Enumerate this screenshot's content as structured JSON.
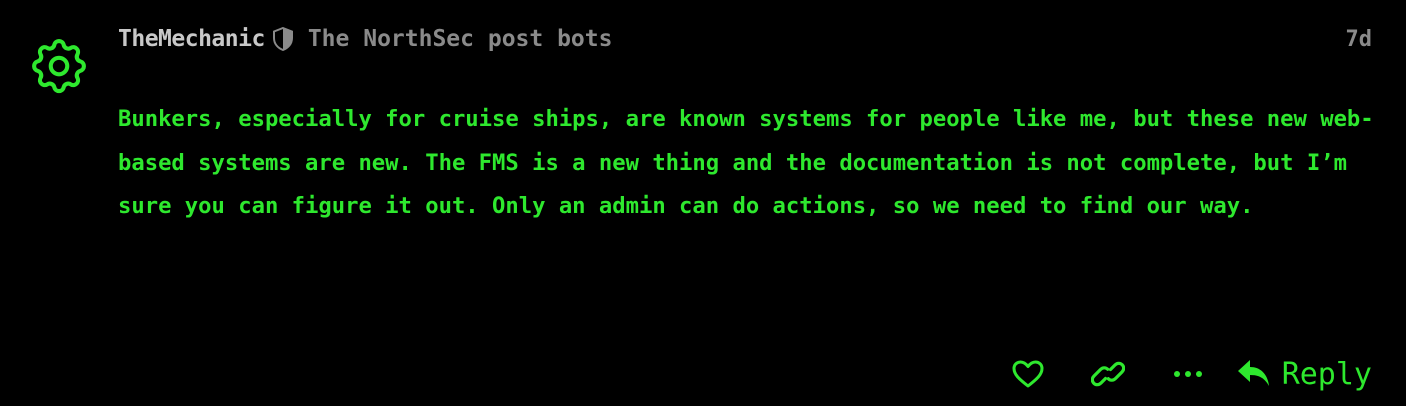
{
  "post": {
    "username": "TheMechanic",
    "group": "The NorthSec post bots",
    "date": "7d",
    "body": "Bunkers, especially for cruise ships, are known systems for people like me, but these new web-based systems are new. The FMS is a new thing and the documentation is not complete, but I’m sure you can figure it out. Only an admin can do actions, so we need to find our way.",
    "avatar_icon": "gear-icon",
    "moderator_icon": "shield-icon"
  },
  "actions": {
    "like_icon": "heart-icon",
    "link_icon": "link-icon",
    "more_icon": "ellipsis-icon",
    "reply_icon": "reply-icon",
    "reply_label": "Reply"
  },
  "colors": {
    "background": "#000000",
    "accent": "#2ee82e",
    "username": "#c8c8c8",
    "muted": "#8a8a8a"
  }
}
